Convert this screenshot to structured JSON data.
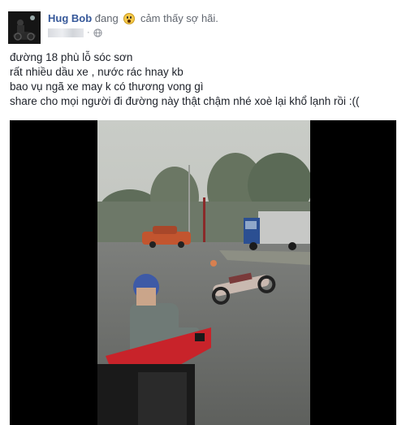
{
  "post": {
    "author": "Hug Bob",
    "activity_prefix": "đang",
    "feeling_icon": "scared-face-emoji",
    "feeling_text": "cảm thấy sợ hãi.",
    "privacy_icon": "globe-icon",
    "lines": [
      "đường 18 phù lỗ sóc sơn",
      "rất nhiều dầu xe , nước rác hnay kb",
      "bao vụ ngã xe may k có thương vong gì",
      "share cho mọi người đi đường này thật chậm nhé xoè lại khổ lạnh rồi :(("
    ]
  },
  "colors": {
    "author": "#365899",
    "meta": "#616770",
    "video_bg": "#000000"
  }
}
